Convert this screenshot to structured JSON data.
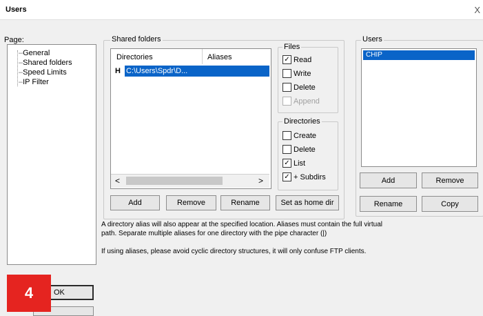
{
  "window": {
    "title": "Users",
    "close_glyph": "X"
  },
  "page_panel": {
    "label": "Page:",
    "items": [
      "General",
      "Shared folders",
      "Speed Limits",
      "IP Filter"
    ]
  },
  "shared_folders": {
    "group_label": "Shared folders",
    "columns": [
      "Directories",
      "Aliases"
    ],
    "rows": [
      {
        "marker": "H",
        "path": "C:\\Users\\Spdr\\D..."
      }
    ],
    "scroll_left": "<",
    "scroll_right": ">",
    "buttons": {
      "add": "Add",
      "remove": "Remove",
      "rename": "Rename",
      "set_home": "Set as home dir"
    }
  },
  "files": {
    "label": "Files",
    "options": [
      {
        "label": "Read",
        "checked": true,
        "enabled": true
      },
      {
        "label": "Write",
        "checked": false,
        "enabled": true
      },
      {
        "label": "Delete",
        "checked": false,
        "enabled": true
      },
      {
        "label": "Append",
        "checked": false,
        "enabled": false
      }
    ]
  },
  "directories": {
    "label": "Directories",
    "options": [
      {
        "label": "Create",
        "checked": false
      },
      {
        "label": "Delete",
        "checked": false
      },
      {
        "label": "List",
        "checked": true
      },
      {
        "label": "+ Subdirs",
        "checked": true
      }
    ]
  },
  "users": {
    "label": "Users",
    "list": [
      "CHIP"
    ],
    "buttons": {
      "add": "Add",
      "remove": "Remove",
      "rename": "Rename",
      "copy": "Copy"
    }
  },
  "notes": {
    "line1": "A directory alias will also appear at the specified location. Aliases must contain the full virtual",
    "line2": "path. Separate multiple aliases for one directory with the pipe character (|)",
    "line3": "If using aliases, please avoid cyclic directory structures, it will only confuse FTP clients."
  },
  "ok_button": "OK",
  "step_badge": "4",
  "colors": {
    "selection": "#0a64c8",
    "badge": "#e52420"
  }
}
